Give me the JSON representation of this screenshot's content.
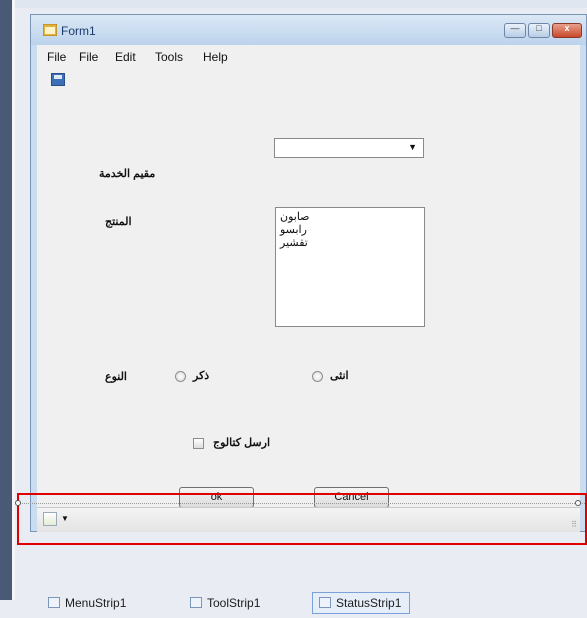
{
  "window": {
    "title": "Form1",
    "minimize_glyph": "—",
    "maximize_glyph": "□",
    "close_glyph": "x"
  },
  "menu": {
    "items": [
      "File",
      "File",
      "Edit",
      "Tools",
      "Help"
    ]
  },
  "form": {
    "product_type_label": "مقيم الخدمة",
    "product_label": "المنتج",
    "list_items": [
      "صابون",
      "رابسو",
      "تقشير"
    ],
    "gender_label": "النوع",
    "male_label": "ذكر",
    "female_label": "انثى",
    "send_label": "ارسل كتالوج",
    "ok_label": "ok",
    "cancel_label": "Cancel"
  },
  "components": [
    "MenuStrip1",
    "ToolStrip1",
    "StatusStrip1"
  ],
  "colors": {
    "selection": "#e00000",
    "title_text": "#1a3a6b"
  }
}
